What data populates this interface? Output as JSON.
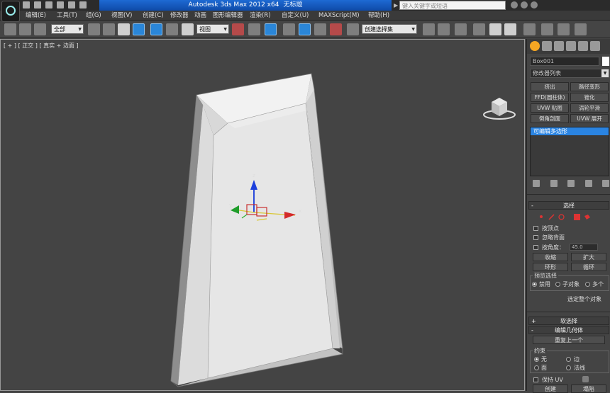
{
  "title_bar": {
    "app_title": "Autodesk 3ds Max  2012 x64",
    "doc_title": "无标题",
    "search_placeholder": "键入关键字或短语"
  },
  "menu": {
    "items": [
      "编辑(E)",
      "工具(T)",
      "组(G)",
      "视图(V)",
      "创建(C)",
      "修改器",
      "动画",
      "图形编辑器",
      "渲染(R)",
      "自定义(U)",
      "MAXScript(M)",
      "帮助(H)"
    ]
  },
  "toolbar": {
    "selection_filter": "全部",
    "reference_coord": "视图",
    "named_selection": "创建选择集"
  },
  "viewport": {
    "label": "[ + ] [ 正交 ] [ 真实 + 边面 ]",
    "gizmo": {
      "x": "x",
      "y": "y",
      "z": "z"
    },
    "colors": {
      "object_light": "#e8e8e8",
      "object_mid": "#c9c9c9",
      "object_dark": "#8e8e8e",
      "background": "#444444"
    }
  },
  "command_panel": {
    "object_name": "Box001",
    "modifier_list": "修改器列表",
    "modifier_buttons": [
      [
        "挤出",
        "路径变形"
      ],
      [
        "FFD(圆柱体)",
        "锥化"
      ],
      [
        "UVW 贴图",
        "涡轮平滑"
      ],
      [
        "倒角剖面",
        "UVW 展开"
      ]
    ],
    "stack_item": "可编辑多边形",
    "selection_rollout": {
      "title": "选择",
      "by_vertex": "按顶点",
      "ignore_backfacing": "忽略背面",
      "by_angle": "按角度：",
      "angle_value": "45.0",
      "shrink": "收缩",
      "grow": "扩大",
      "ring": "环形",
      "loop": "循环",
      "preview_group": "预览选择",
      "disable": "禁用",
      "subobject": "子对象",
      "multi": "多个",
      "status": "选定整个对象"
    },
    "soft_selection": "软选择",
    "edit_geometry": {
      "title": "编辑几何体",
      "repeat_last": "重复上一个",
      "constraints_group": "约束",
      "none": "无",
      "edge": "边",
      "face": "面",
      "normal": "法线",
      "preserve_uv": "保持 UV",
      "create": "创建",
      "collapse": "塌陷"
    }
  },
  "accent_colors": {
    "active_blue": "#2a84e2",
    "title_blue": "#1e6ad3",
    "panel_bg": "#444444"
  }
}
